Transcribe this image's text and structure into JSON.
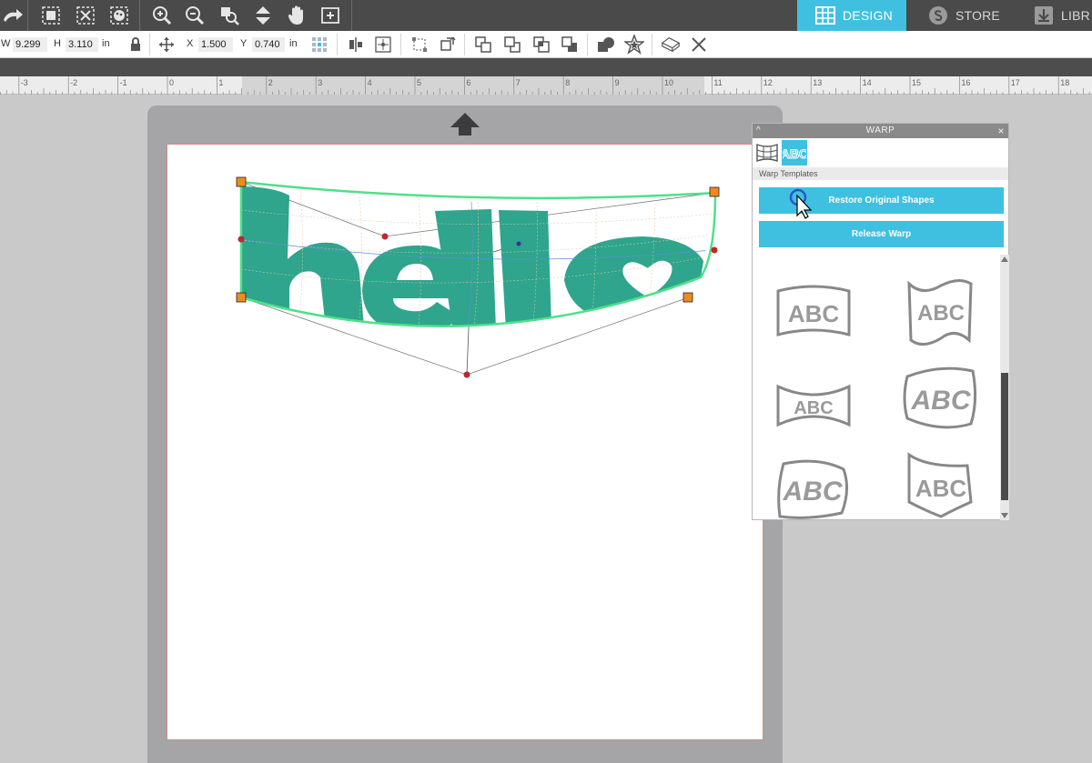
{
  "nav": {
    "tabs": [
      {
        "label": "DESIGN",
        "icon": "grid-icon",
        "active": true
      },
      {
        "label": "STORE",
        "icon": "store-icon",
        "active": false
      },
      {
        "label": "LIBR",
        "icon": "library-icon",
        "active": false
      }
    ]
  },
  "toolbar2": {
    "w_label": "W",
    "w_value": "9.299",
    "h_label": "H",
    "h_value": "3.110",
    "size_unit": "in",
    "x_label": "X",
    "x_value": "1.500",
    "y_label": "Y",
    "y_value": "0.740",
    "pos_unit": "in"
  },
  "ruler": {
    "labels": [
      "-3",
      "-2",
      "-1",
      "0",
      "1",
      "2",
      "3",
      "4",
      "5",
      "6",
      "7",
      "8",
      "9",
      "10",
      "11",
      "12",
      "13",
      "14",
      "15",
      "16",
      "17",
      "18"
    ]
  },
  "warp_panel": {
    "title": "WARP",
    "collapse_glyph": "^",
    "close_glyph": "×",
    "abc_tab_label": "ABC",
    "section_label": "Warp Templates",
    "restore_button": "Restore Original Shapes",
    "release_button": "Release Warp",
    "template_text": "ABC"
  },
  "colors": {
    "accent": "#3fc0e0",
    "topbar": "#4a4a4a",
    "shape_fill": "#2ea58c",
    "warp_outline": "#4fe08a",
    "handle": "#f08a1c",
    "control_point": "#c0262c"
  }
}
